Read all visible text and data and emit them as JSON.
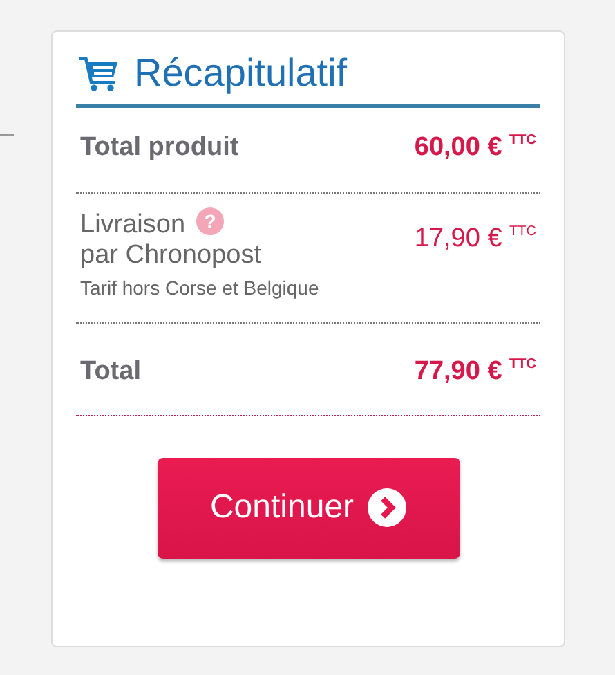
{
  "title": "Récapitulatif",
  "rows": [
    {
      "kind": "subtotal",
      "label": "Total produit",
      "price": "60,00 € $^{TTC}$"
    },
    {
      "kind": "shipping",
      "label": "Livraison",
      "help": "?",
      "carrier": "par Chronopost",
      "note": "Tarif hors Corse et Belgique",
      "price": "17,90 € $^{TTC}$"
    },
    {
      "kind": "total",
      "label": "Total",
      "price": "77,90 € $^{TTC}$"
    }
  ],
  "button": {
    "label": "Continuer"
  }
}
